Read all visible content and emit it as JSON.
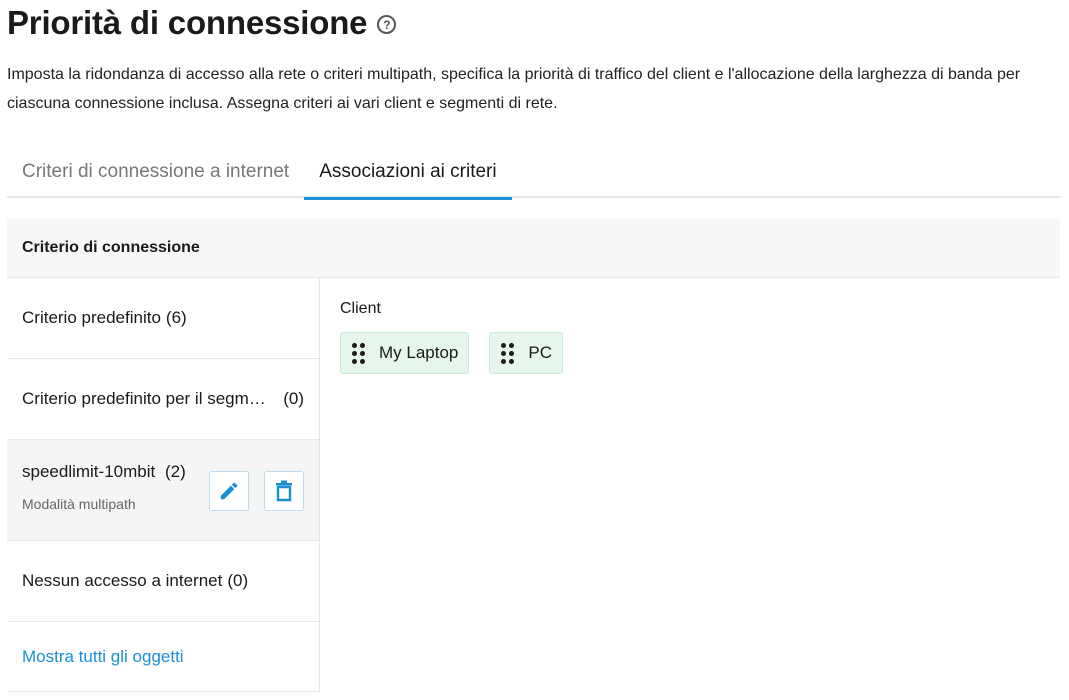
{
  "page": {
    "title": "Priorità di connessione",
    "help_icon": "question-circle-icon",
    "help_glyph": "?",
    "description": "Imposta la ridondanza di accesso alla rete o criteri multipath, specifica la priorità di traffico del client e l'allocazione della larghezza di banda per ciascuna connessione inclusa. Assegna criteri ai vari client e segmenti di rete."
  },
  "tabs": [
    {
      "label": "Criteri di connessione a internet",
      "active": false
    },
    {
      "label": "Associazioni ai criteri",
      "active": true
    }
  ],
  "panel": {
    "header": "Criterio di connessione"
  },
  "policies": [
    {
      "label": "Criterio predefinito",
      "count": "(6)"
    },
    {
      "label": "Criterio predefinito per il segmento di rete",
      "count": "(0)"
    },
    {
      "label": "speedlimit-10mbit",
      "count": "(2)",
      "sub_label": "Modalità multipath",
      "selected": true
    },
    {
      "label": "Nessun accesso a internet",
      "count": "(0)"
    }
  ],
  "show_all_label": "Mostra tutti gli oggetti",
  "clients": {
    "label": "Client",
    "items": [
      "My Laptop",
      "PC"
    ]
  },
  "colors": {
    "accent": "#1a8fd3",
    "chip_bg": "#e6f6ed",
    "chip_border": "#c5ead6"
  }
}
